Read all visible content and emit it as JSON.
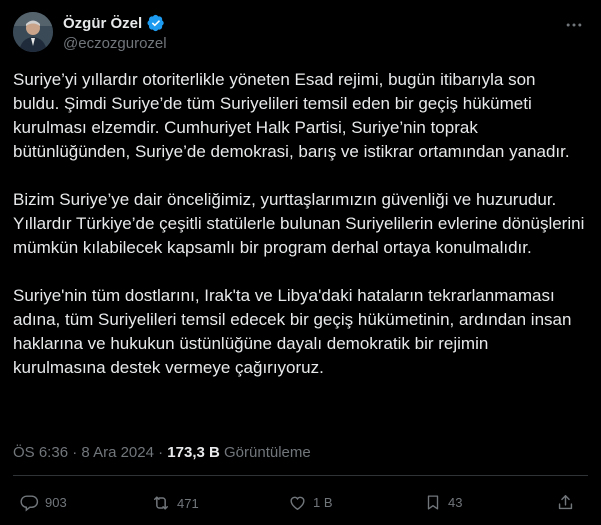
{
  "author": {
    "name": "Özgür Özel",
    "handle": "@eczozgurozel"
  },
  "tweet": {
    "paragraphs": [
      "Suriye’yi yıllardır otoriterlikle yöneten Esad rejimi, bugün itibarıyla son buldu. Şimdi Suriye’de tüm Suriyelileri temsil eden bir geçiş hükümeti kurulması elzemdir. Cumhuriyet Halk Partisi, Suriye’nin toprak bütünlüğünden, Suriye’de demokrasi, barış ve istikrar ortamından yanadır.",
      "Bizim Suriye’ye dair önceliğimiz, yurttaşlarımızın güvenliği ve huzurudur. Yıllardır Türkiye’de çeşitli statülerle bulunan Suriyelilerin evlerine dönüşlerini mümkün kılabilecek kapsamlı bir program derhal ortaya konulmalıdır.",
      "Suriye'nin tüm dostlarını, Irak'ta ve Libya'daki hataların tekrarlanmaması adına, tüm Suriyelileri temsil edecek bir geçiş hükümetinin, ardından insan haklarına ve hukukun üstünlüğüne dayalı demokratik bir rejimin kurulmasına destek vermeye çağırıyoruz."
    ]
  },
  "meta": {
    "time": "ÖS 6:36",
    "separator": "·",
    "date": "8 Ara 2024",
    "views_count": "173,3 B",
    "views_label": "Görüntüleme"
  },
  "actions": {
    "replies": "903",
    "reposts": "471",
    "likes": "1 B",
    "bookmarks": "43"
  },
  "icons": {
    "verified": "verified-badge-icon",
    "more": "more-icon",
    "reply": "reply-icon",
    "repost": "repost-icon",
    "like": "like-icon",
    "bookmark": "bookmark-icon",
    "share": "share-icon"
  },
  "colors": {
    "background": "#000000",
    "text": "#e7e9ea",
    "secondary": "#71767b",
    "verified": "#1d9bf0",
    "divider": "#2f3336"
  }
}
